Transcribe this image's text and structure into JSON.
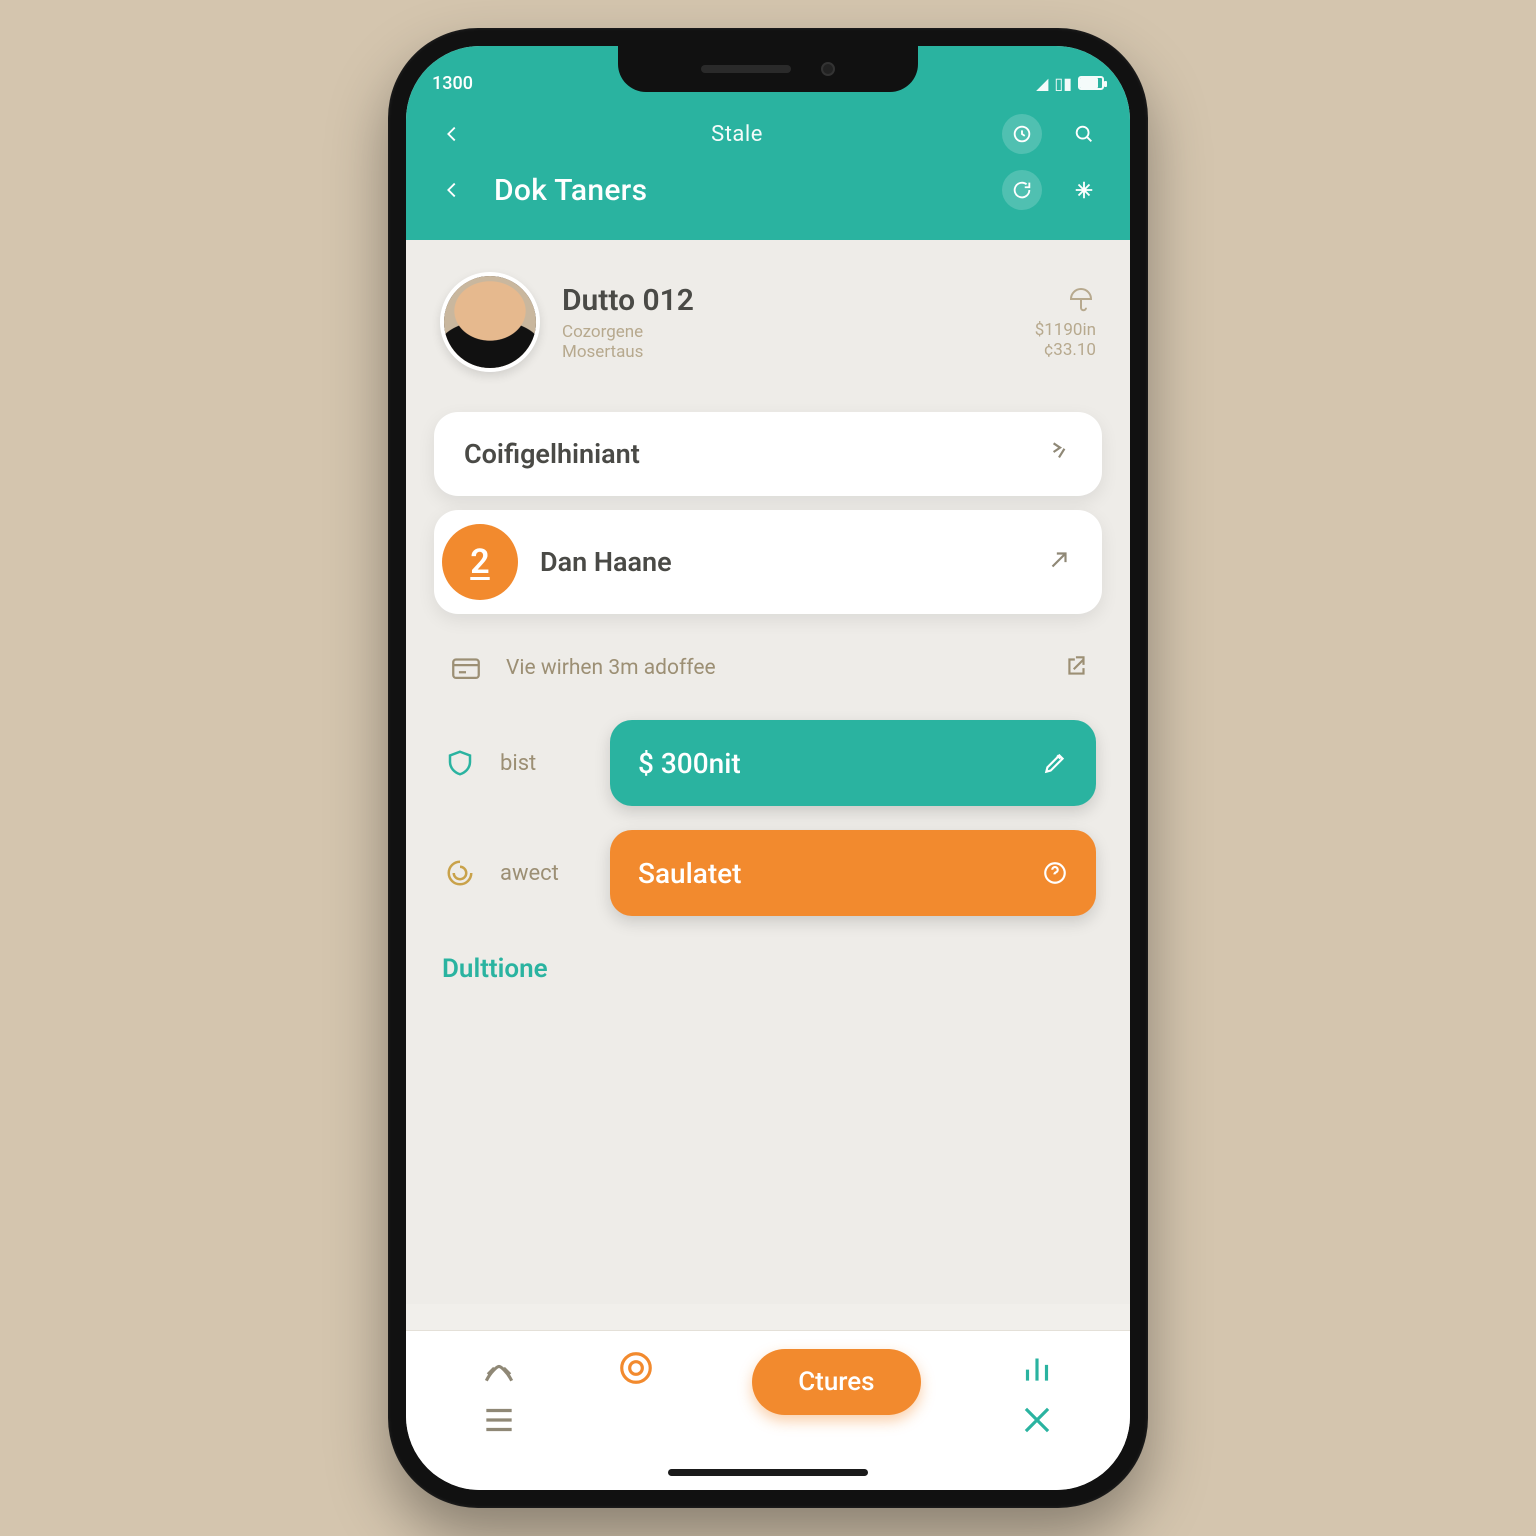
{
  "status": {
    "time": "1300",
    "indicators": "▮▯◧"
  },
  "header": {
    "subtitle": "Stale",
    "title": "Dok Taners"
  },
  "profile": {
    "name": "Dutto 012",
    "sub1": "Cozorgene",
    "sub2": "Mosertaus",
    "amount1": "$1190in",
    "amount2": "¢33.10"
  },
  "cards": [
    {
      "label": "Coifigelhiniant"
    },
    {
      "badge": "2",
      "label": "Dan Haane"
    }
  ],
  "rows": {
    "info": "Vie wirhen 3m adoffee",
    "a1_label": "bist",
    "a1_btn": "$ 300nit",
    "a2_label": "awect",
    "a2_btn": "Saulatet"
  },
  "section": "Dulttione",
  "bottom": {
    "pill": "Ctures"
  },
  "colors": {
    "teal": "#2ab3a0",
    "orange": "#f28a2e"
  }
}
